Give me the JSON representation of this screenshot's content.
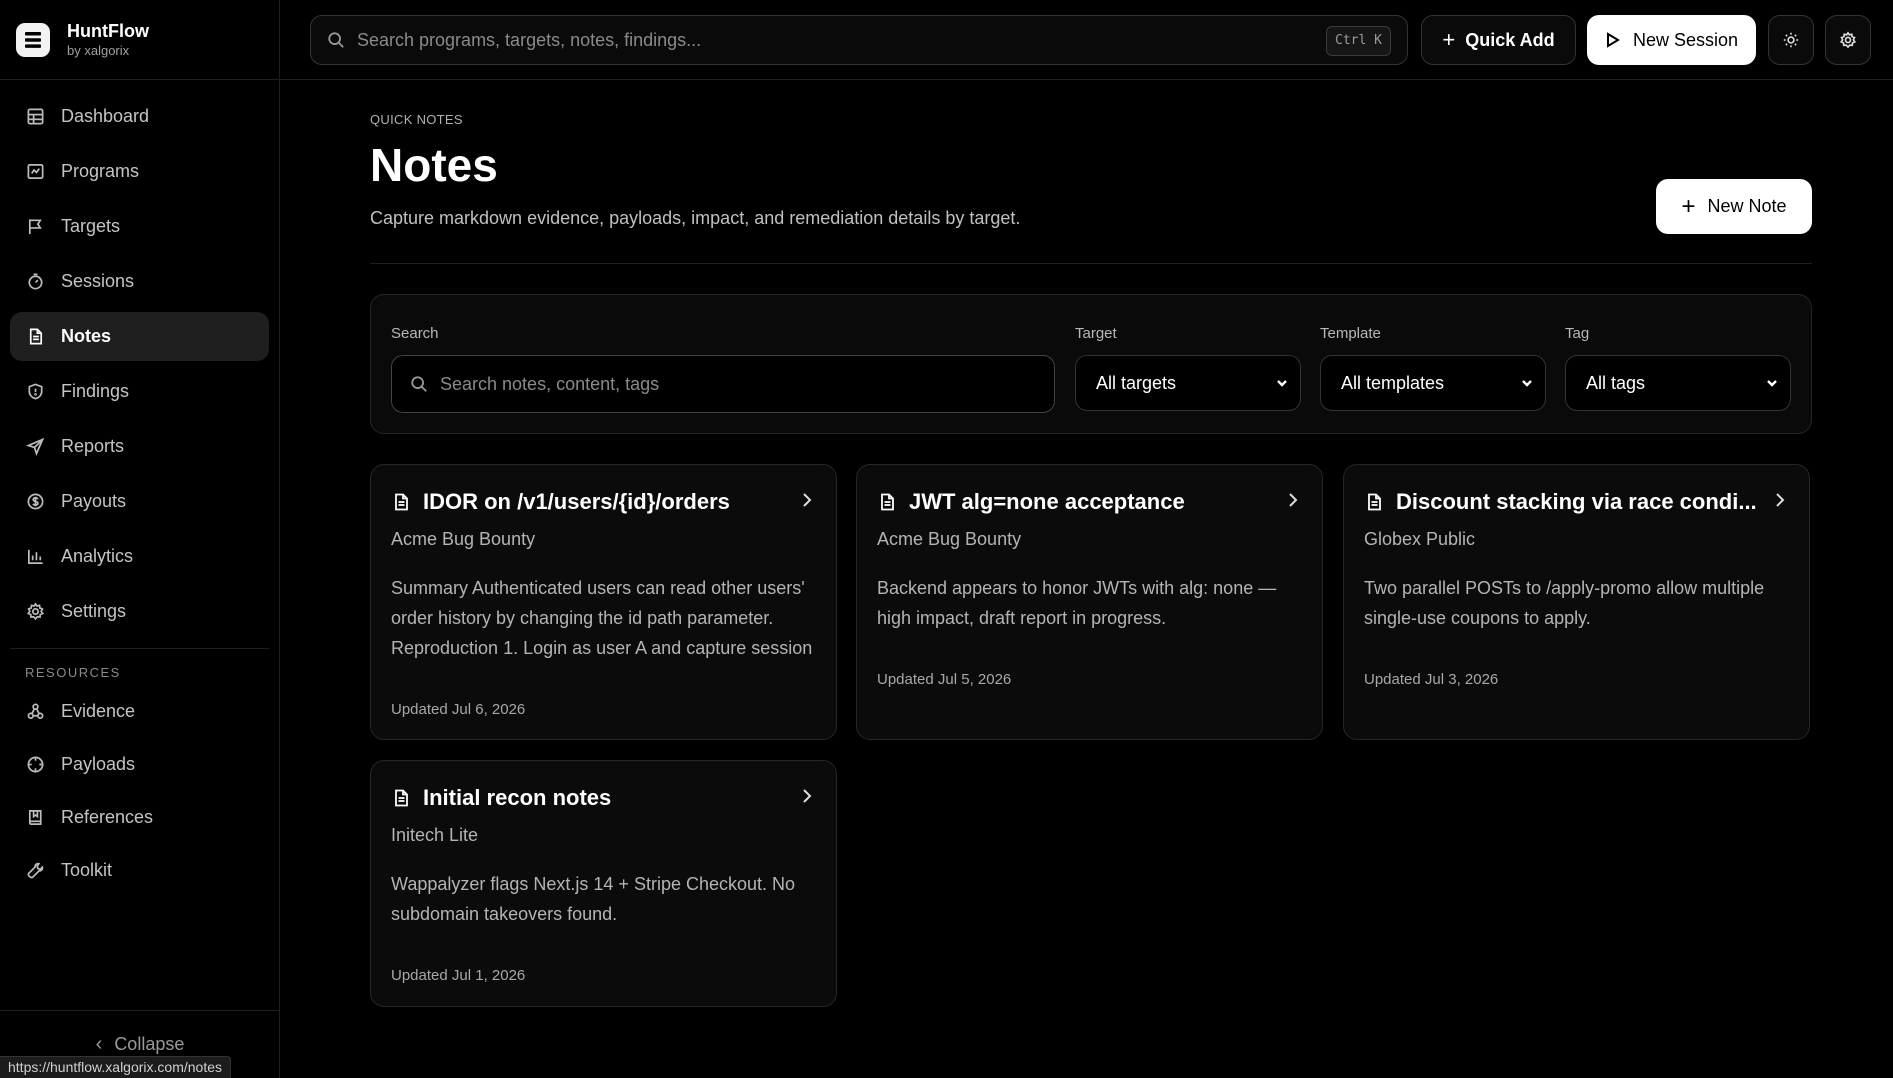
{
  "brand": {
    "name": "HuntFlow",
    "by": "by xalgorix"
  },
  "sidebar": {
    "items": [
      {
        "label": "Dashboard",
        "icon": "dashboard-icon"
      },
      {
        "label": "Programs",
        "icon": "programs-icon"
      },
      {
        "label": "Targets",
        "icon": "flag-icon"
      },
      {
        "label": "Sessions",
        "icon": "timer-icon"
      },
      {
        "label": "Notes",
        "icon": "note-icon",
        "active": true
      },
      {
        "label": "Findings",
        "icon": "shield-icon"
      },
      {
        "label": "Reports",
        "icon": "send-icon"
      },
      {
        "label": "Payouts",
        "icon": "dollar-icon"
      },
      {
        "label": "Analytics",
        "icon": "bar-chart-icon"
      },
      {
        "label": "Settings",
        "icon": "gear-icon"
      }
    ],
    "resources_label": "RESOURCES",
    "resources": [
      {
        "label": "Evidence",
        "icon": "evidence-icon"
      },
      {
        "label": "Payloads",
        "icon": "crosshair-icon"
      },
      {
        "label": "References",
        "icon": "book-icon"
      },
      {
        "label": "Toolkit",
        "icon": "wrench-icon"
      }
    ],
    "collapse_label": "Collapse"
  },
  "topbar": {
    "search_placeholder": "Search programs, targets, notes, findings...",
    "shortcut": "Ctrl K",
    "quick_add": "Quick Add",
    "new_session": "New Session"
  },
  "page": {
    "eyebrow": "QUICK NOTES",
    "title": "Notes",
    "subtitle": "Capture markdown evidence, payloads, impact, and remediation details by target.",
    "new_note": "New Note"
  },
  "filters": {
    "search_label": "Search",
    "search_placeholder": "Search notes, content, tags",
    "target_label": "Target",
    "target_value": "All targets",
    "template_label": "Template",
    "template_value": "All templates",
    "tag_label": "Tag",
    "tag_value": "All tags"
  },
  "notes": [
    {
      "title": "IDOR on /v1/users/{id}/orders",
      "program": "Acme Bug Bounty",
      "preview": "Summary Authenticated users can read other users' order history by changing the id path parameter. Reproduction 1. Login as user A and capture session",
      "updated": "Updated Jul 6, 2026"
    },
    {
      "title": "JWT alg=none acceptance",
      "program": "Acme Bug Bounty",
      "preview": "Backend appears to honor JWTs with alg: none — high impact, draft report in progress.",
      "updated": "Updated Jul 5, 2026"
    },
    {
      "title": "Discount stacking via race condi...",
      "program": "Globex Public",
      "preview": "Two parallel POSTs to /apply-promo allow multiple single-use coupons to apply.",
      "updated": "Updated Jul 3, 2026"
    },
    {
      "title": "Initial recon notes",
      "program": "Initech Lite",
      "preview": "Wappalyzer flags Next.js 14 + Stripe Checkout. No subdomain takeovers found.",
      "updated": "Updated Jul 1, 2026"
    }
  ],
  "statusbar": {
    "url": "https://huntflow.xalgorix.com/notes"
  }
}
